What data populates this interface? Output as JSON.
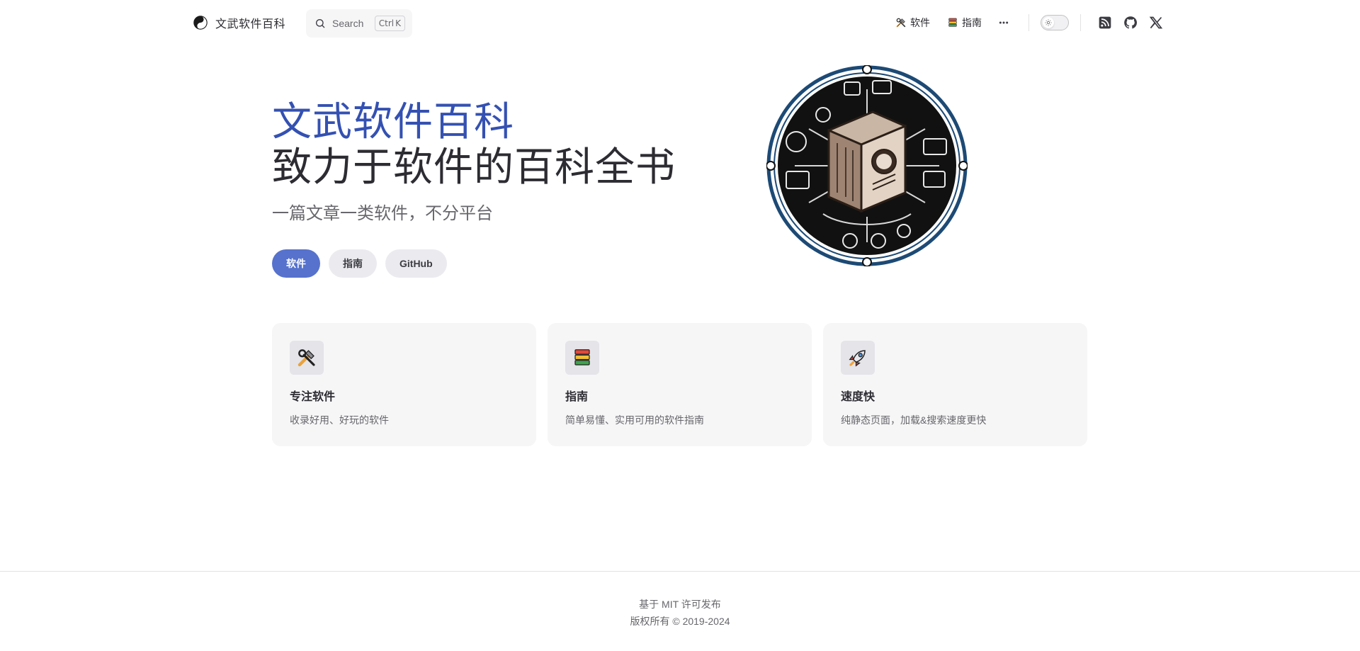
{
  "nav": {
    "title": "文武软件百科",
    "search": {
      "placeholder": "Search",
      "key1": "Ctrl",
      "key2": "K"
    },
    "links": [
      {
        "label": "软件",
        "icon": "tools-icon"
      },
      {
        "label": "指南",
        "icon": "books-icon"
      }
    ],
    "more_icon": "more-horizontal-icon",
    "theme_toggle_icon": "sun-icon",
    "social": [
      "rss-icon",
      "github-icon",
      "x-icon"
    ]
  },
  "hero": {
    "name": "文武软件百科",
    "text": "致力于软件的百科全书",
    "tagline": "一篇文章一类软件，不分平台",
    "actions": [
      {
        "label": "软件",
        "theme": "brand"
      },
      {
        "label": "指南",
        "theme": "alt"
      },
      {
        "label": "GitHub",
        "theme": "alt"
      }
    ],
    "image": "encyclopedia-book-logo"
  },
  "features": [
    {
      "icon": "tools-icon",
      "title": "专注软件",
      "details": "收录好用、好玩的软件"
    },
    {
      "icon": "books-icon",
      "title": "指南",
      "details": "简单易懂、实用可用的软件指南"
    },
    {
      "icon": "rocket-icon",
      "title": "速度快",
      "details": "纯静态页面，加载&搜索速度更快"
    }
  ],
  "footer": {
    "message": "基于 MIT 许可发布",
    "copyright": "版权所有 © 2019-2024"
  },
  "colors": {
    "brand": "#3451b2",
    "button_brand": "#5672cd",
    "text": "#2c2c32",
    "muted": "#67676c",
    "card_bg": "#f6f6f7"
  }
}
